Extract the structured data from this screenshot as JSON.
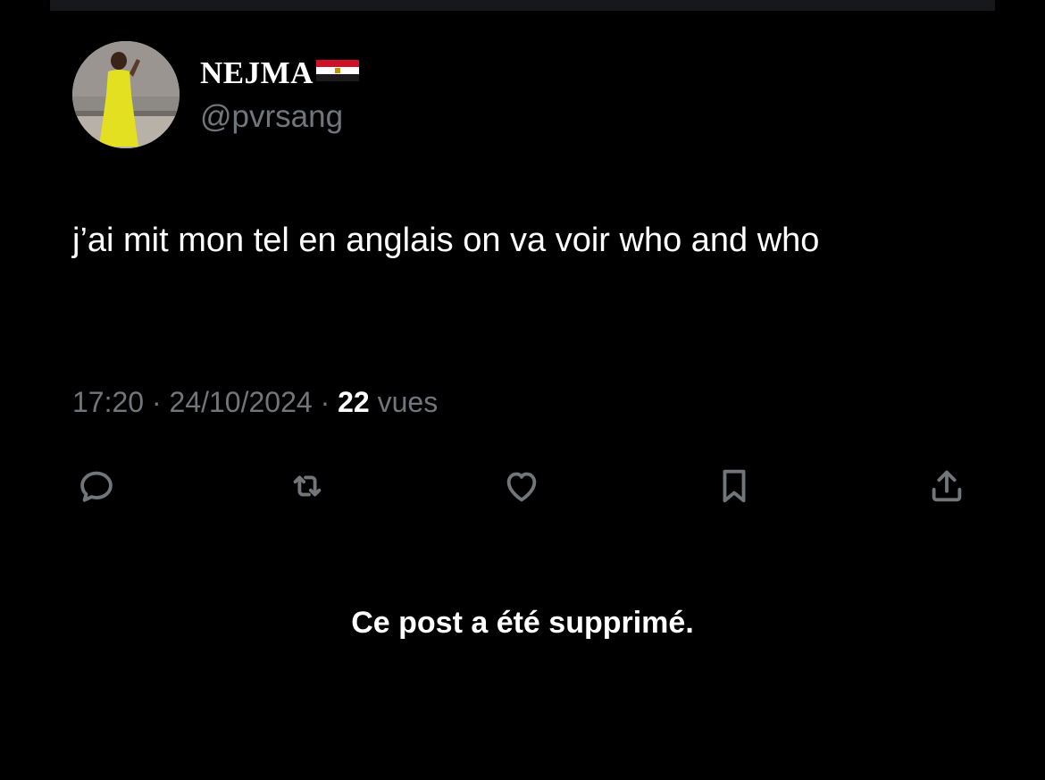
{
  "tweet": {
    "author": {
      "display_name": "NEJMA",
      "flag": "egypt-flag",
      "handle": "@pvrsang"
    },
    "text": "j’ai mit mon tel en anglais on va voir who and who",
    "meta": {
      "time": "17:20",
      "separator": "·",
      "date": "24/10/2024",
      "views_count": "22",
      "views_label": "vues"
    },
    "actions": [
      "reply-icon",
      "retweet-icon",
      "like-icon",
      "bookmark-icon",
      "share-icon"
    ]
  },
  "notice": {
    "deleted_text": "Ce post a été supprimé."
  },
  "colors": {
    "background": "#000000",
    "text_primary": "#ffffff",
    "text_secondary": "#71767b",
    "icon": "#71767b"
  }
}
